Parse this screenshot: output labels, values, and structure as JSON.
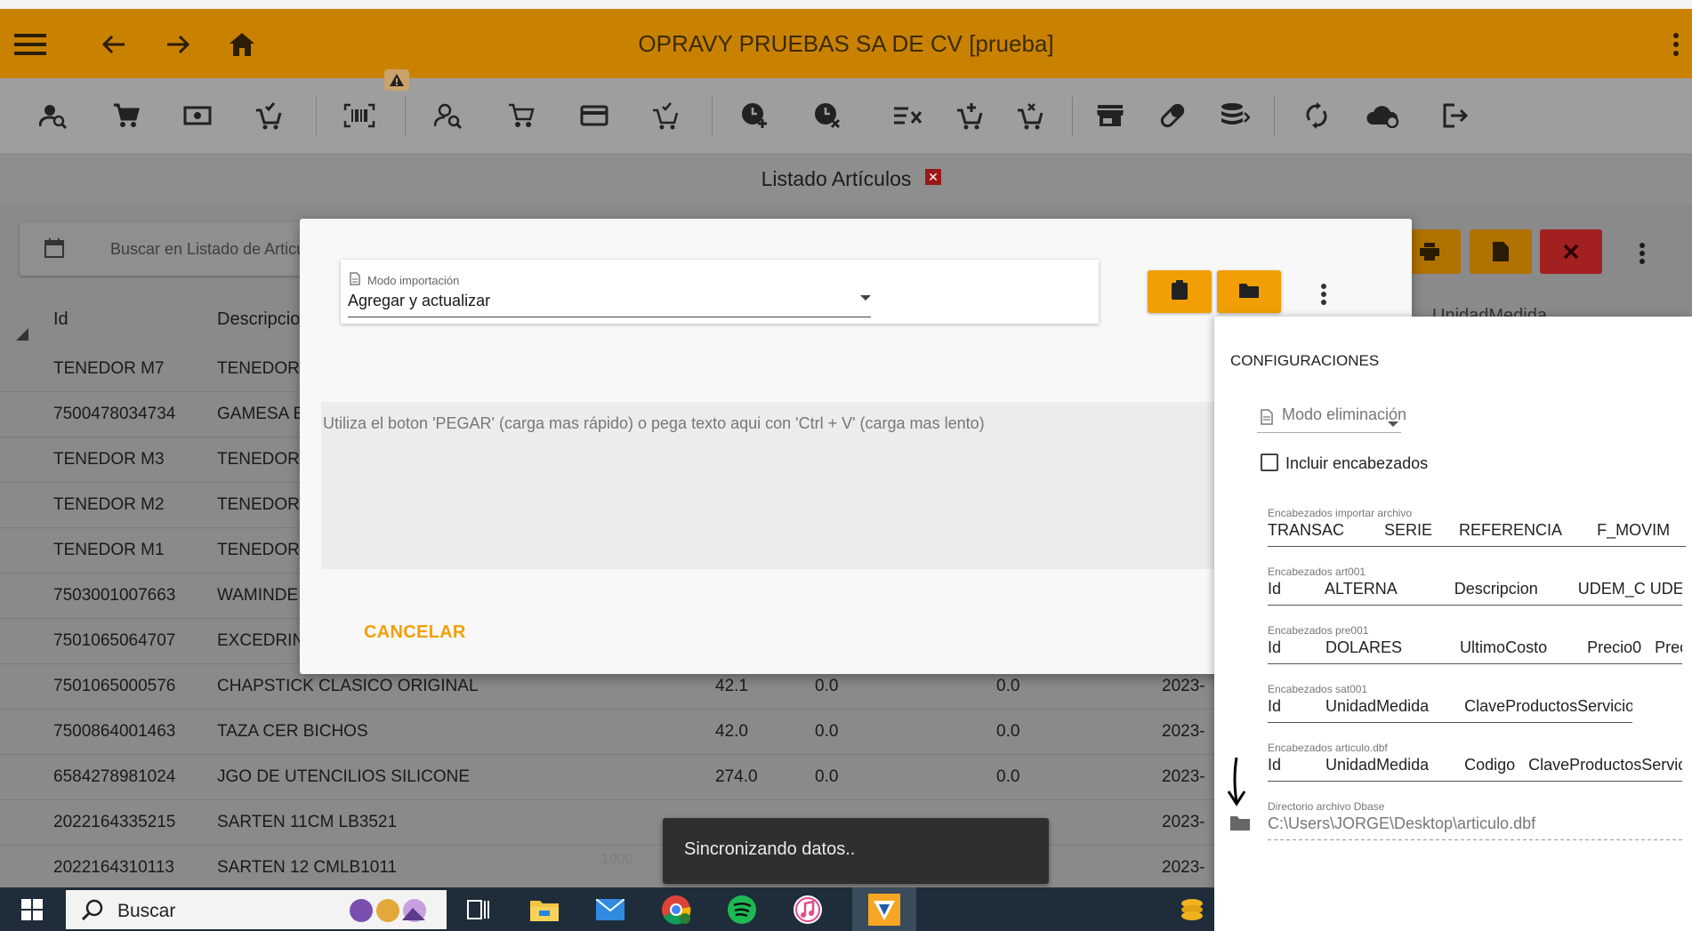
{
  "appbar": {
    "title": "OPRAVY PRUEBAS SA DE CV [prueba]",
    "icons": [
      "menu-icon",
      "arrow-back-icon",
      "arrow-forward-icon",
      "home-icon",
      "more-vert-icon"
    ]
  },
  "toolbar": {
    "icons": [
      "person-search-icon",
      "cart-icon",
      "cash-icon",
      "cart-check-icon",
      "barcode-icon",
      "person-search-icon",
      "cart-outline-icon",
      "card-icon",
      "cart-check-icon",
      "clock-add-icon",
      "clock-remove-icon",
      "list-remove-icon",
      "cart-add-icon",
      "cart-remove-icon",
      "store-icon",
      "pill-icon",
      "database-sync-icon",
      "sync-icon",
      "cloud-sync-icon",
      "logout-icon"
    ],
    "warning_icon": "warning-icon"
  },
  "list": {
    "title": "Listado Artículos",
    "search_placeholder": "Buscar en Listado de Articulos",
    "columns": {
      "id": "Id",
      "descripcion": "Descripcio",
      "unidad": "UnidadMedida"
    },
    "rows": [
      {
        "id": "TENEDOR M7",
        "desc": "TENEDOR",
        "a": "",
        "b": "",
        "c": "",
        "d": ""
      },
      {
        "id": "7500478034734",
        "desc": "GAMESA E",
        "a": "",
        "b": "",
        "c": "",
        "d": ""
      },
      {
        "id": "TENEDOR M3",
        "desc": "TENEDOR",
        "a": "",
        "b": "",
        "c": "",
        "d": ""
      },
      {
        "id": "TENEDOR M2",
        "desc": "TENEDOR",
        "a": "",
        "b": "",
        "c": "",
        "d": ""
      },
      {
        "id": "TENEDOR M1",
        "desc": "TENEDOR",
        "a": "",
        "b": "",
        "c": "",
        "d": ""
      },
      {
        "id": "7503001007663",
        "desc": "WAMINDE",
        "a": "",
        "b": "",
        "c": "",
        "d": ""
      },
      {
        "id": "7501065064707",
        "desc": "EXCEDRIN",
        "a": "",
        "b": "",
        "c": "",
        "d": ""
      },
      {
        "id": "7501065000576",
        "desc": "CHAPSTICK CLASICO ORIGINAL",
        "a": "42.1",
        "b": "0.0",
        "c": "0.0",
        "d": "2023-"
      },
      {
        "id": "7500864001463",
        "desc": "TAZA CER BICHOS",
        "a": "42.0",
        "b": "0.0",
        "c": "0.0",
        "d": "2023-"
      },
      {
        "id": "6584278981024",
        "desc": "JGO DE UTENCILIOS SILICONE",
        "a": "274.0",
        "b": "0.0",
        "c": "0.0",
        "d": "2023-"
      },
      {
        "id": "2022164335215",
        "desc": "SARTEN 11CM LB3521",
        "a": "",
        "b": "",
        "c": "",
        "d": "2023-"
      },
      {
        "id": "2022164310113",
        "desc": "SARTEN 12 CMLB1011",
        "a": "",
        "b": "",
        "c": "",
        "d": "2023-"
      }
    ],
    "pager_text": "1000"
  },
  "dialog": {
    "mode_label": "Modo importación",
    "mode_value": "Agregar y actualizar",
    "textarea_placeholder": "Utiliza el boton 'PEGAR' (carga mas rápido) o pega texto aqui con 'Ctrl + V' (carga mas lento)",
    "cancel_label": "CANCELAR"
  },
  "config": {
    "title": "CONFIGURACIONES",
    "delete_mode_placeholder": "Modo eliminación",
    "include_headers_label": "Incluir encabezados",
    "fields": [
      {
        "label": "Encabezados importar archivo",
        "value": "TRANSAC         SERIE      REFERENCIA        F_MOVIM"
      },
      {
        "label": "Encabezados art001",
        "value": "Id          ALTERNA             Descripcion         UDEM_C UDE"
      },
      {
        "label": "Encabezados pre001",
        "value": "Id          DOLARES             UltimoCosto         Precio0   Prec"
      },
      {
        "label": "Encabezados sat001",
        "value": "Id          UnidadMedida        ClaveProductosServicios"
      },
      {
        "label": "Encabezados articulo.dbf",
        "value": "Id          UnidadMedida        Codigo   ClaveProductosServicio"
      },
      {
        "label": "Directorio archivo Dbase",
        "value": "C:\\Users\\JORGE\\Desktop\\articulo.dbf"
      }
    ]
  },
  "snackbar": {
    "text": "Sincronizando datos.."
  },
  "taskbar": {
    "search_text": "Buscar"
  },
  "colors": {
    "appbar": "#c98200",
    "accent": "#f29f05",
    "danger": "#c62828"
  }
}
